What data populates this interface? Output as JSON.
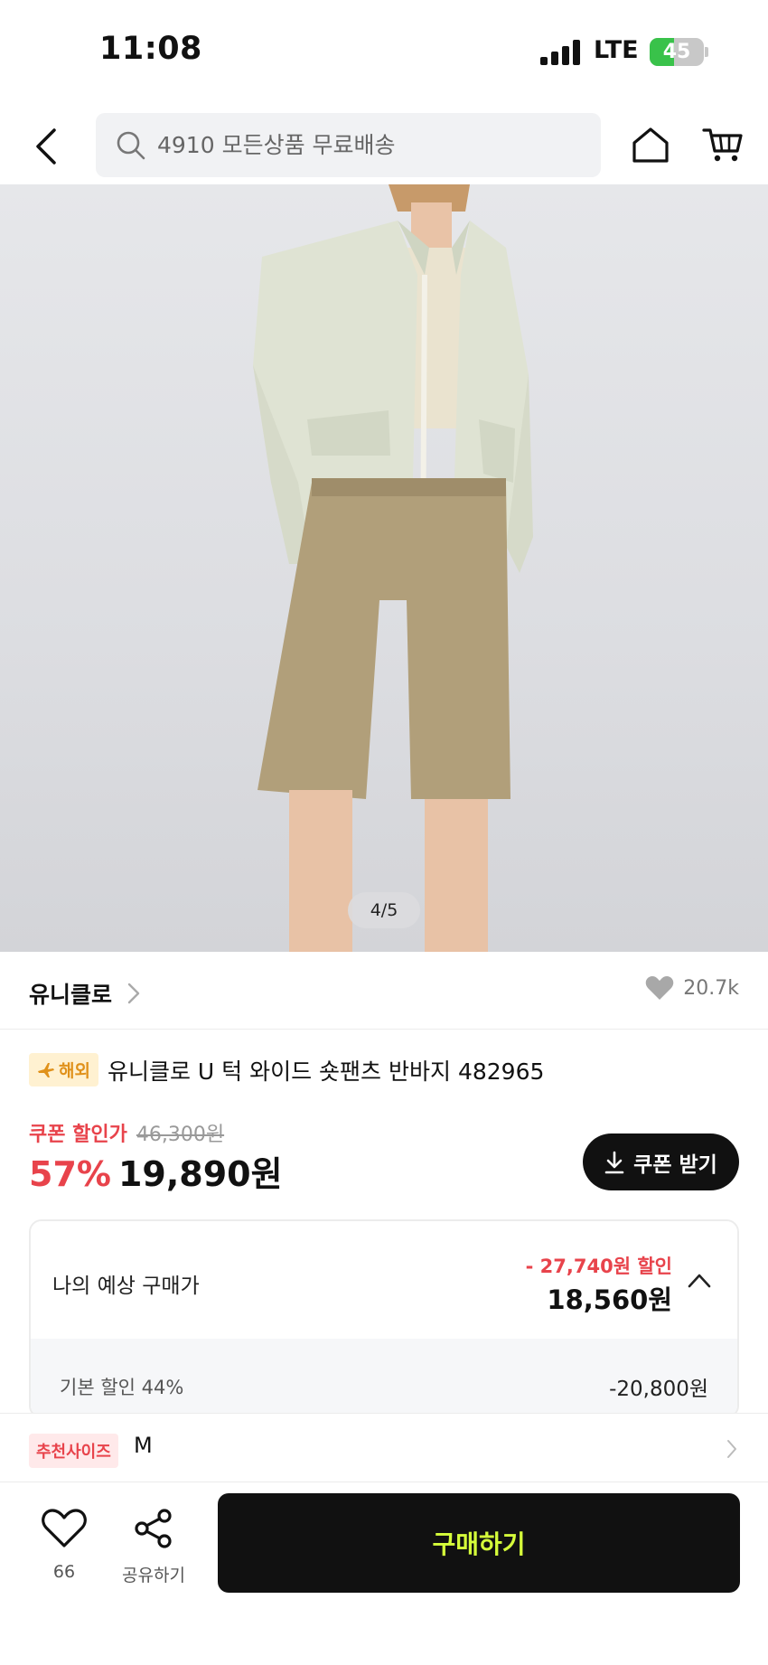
{
  "status_bar": {
    "time": "11:08",
    "network": "LTE",
    "battery_level": "45",
    "battery_fraction": 0.45,
    "battery_color": "#39c24a"
  },
  "top_nav": {
    "search_placeholder": "4910 모든상품 무료배송",
    "icons": [
      "back-arrow-icon",
      "search-icon",
      "home-icon",
      "cart-icon"
    ]
  },
  "product_image": {
    "counter": "4/5"
  },
  "brand": {
    "name": "유니클로",
    "like_count": "20.7k"
  },
  "product": {
    "badge": "해외",
    "title": "유니클로 U 턱 와이드 숏팬츠 반바지 482965"
  },
  "pricing": {
    "coupon_label": "쿠폰 할인가",
    "original_price": "46,300원",
    "discount_rate": "57%",
    "final_price": "19,890원",
    "coupon_button": "쿠폰 받기"
  },
  "expected_price": {
    "label": "나의 예상 구매가",
    "discount": "- 27,740원 할인",
    "price": "18,560원",
    "detail_label": "기본 할인 44%",
    "detail_value": "-20,800원"
  },
  "size": {
    "badge": "추천사이즈",
    "value": "M"
  },
  "bottom_bar": {
    "like_count": "66",
    "share_label": "공유하기",
    "buy_label": "구매하기"
  },
  "colors": {
    "accent_red": "#e8434b",
    "buy_text": "#d6ff3a",
    "dark": "#111111"
  }
}
